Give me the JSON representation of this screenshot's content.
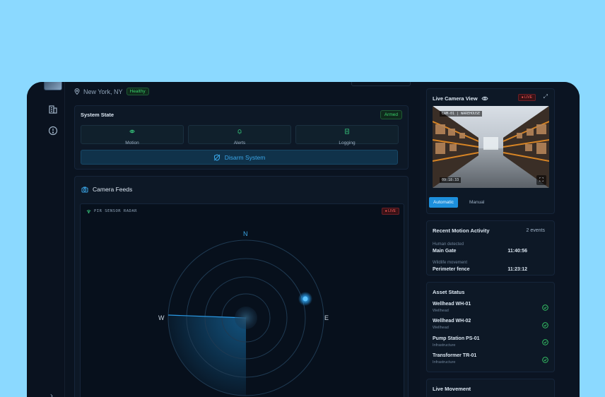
{
  "header": {
    "location": "New York, NY",
    "health_badge": "Healthy"
  },
  "system_state": {
    "title": "System State",
    "status_badge": "Armed",
    "tiles": [
      {
        "label": "Motion",
        "icon": "eye-icon"
      },
      {
        "label": "Alerts",
        "icon": "bell-icon"
      },
      {
        "label": "Logging",
        "icon": "document-icon"
      }
    ],
    "disarm_label": "Disarm System"
  },
  "camera_feeds": {
    "title": "Camera Feeds",
    "radar_label": "PIR SENSOR RADAR",
    "live_label": "LIVE",
    "compass": {
      "n": "N",
      "w": "W",
      "e": "E"
    }
  },
  "live_camera": {
    "title": "Live Camera View",
    "live_label": "LIVE",
    "camera_tag": "CAM-01 | WAREHOUSE",
    "timestamp": "09:18:33",
    "modes": {
      "automatic": "Automatic",
      "manual": "Manual"
    }
  },
  "motion_activity": {
    "title": "Recent Motion Activity",
    "count": "2 events",
    "events": [
      {
        "type": "Human detected",
        "location": "Main Gate",
        "time": "11:40:56"
      },
      {
        "type": "Wildlife movement",
        "location": "Perimeter fence",
        "time": "11:23:12"
      }
    ]
  },
  "asset_status": {
    "title": "Asset Status",
    "assets": [
      {
        "name": "Wellhead WH-01",
        "type": "Wellhead"
      },
      {
        "name": "Wellhead WH-02",
        "type": "Wellhead"
      },
      {
        "name": "Pump Station PS-01",
        "type": "Infrastructure"
      },
      {
        "name": "Transformer TR-01",
        "type": "Infrastructure"
      }
    ]
  },
  "live_movement": {
    "title": "Live Movement"
  },
  "colors": {
    "accent": "#1d8fdc",
    "ok": "#38d06a",
    "alert": "#ff5a5a",
    "background": "#0b1422"
  }
}
